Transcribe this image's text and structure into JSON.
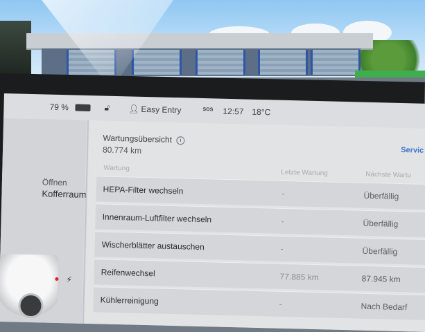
{
  "status_bar": {
    "battery_percent": "79 %",
    "profile_name": "Easy Entry",
    "sos_label": "SOS",
    "time": "12:57",
    "temperature": "18°C"
  },
  "left_panel": {
    "open_label": "Öffnen",
    "trunk_label": "Kofferraum"
  },
  "maintenance": {
    "title": "Wartungsübersicht",
    "odometer": "80.774 km",
    "service_link": "Servic",
    "columns": {
      "task": "Wartung",
      "last": "Letzte Wartung",
      "next": "Nächste Wartu"
    },
    "rows": [
      {
        "task": "HEPA-Filter wechseln",
        "last": "-",
        "next": "Überfällig"
      },
      {
        "task": "Innenraum-Luftfilter wechseln",
        "last": "-",
        "next": "Überfällig"
      },
      {
        "task": "Wischerblätter austauschen",
        "last": "-",
        "next": "Überfällig"
      },
      {
        "task": "Reifenwechsel",
        "last": "77.885 km",
        "next": "87.945 km"
      },
      {
        "task": "Kühlerreinigung",
        "last": "-",
        "next": "Nach Bedarf"
      }
    ]
  },
  "colors": {
    "accent_blue": "#3a74c8",
    "screen_bg": "#dcdde0",
    "row_bg": "#d5d6d9"
  }
}
